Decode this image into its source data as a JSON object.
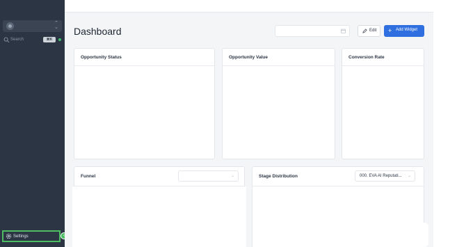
{
  "sidebar": {
    "search_label": "Search",
    "search_shortcut": "⌘K",
    "settings_label": "Settings"
  },
  "header": {
    "title": "Dashboard",
    "date_value": "",
    "edit_label": "Edit",
    "add_widget_label": "Add Widget"
  },
  "widgets": {
    "opportunity_status": {
      "title": "Opportunity Status"
    },
    "opportunity_value": {
      "title": "Opportunity Value"
    },
    "conversion_rate": {
      "title": "Conversion Rate"
    },
    "funnel": {
      "title": "Funnel",
      "select_value": ""
    },
    "stage_distribution": {
      "title": "Stage Distribution",
      "select_value": "000. EVA AI Reputati..."
    }
  },
  "colors": {
    "sidebar_bg": "#2b3544",
    "accent": "#2f6fdf",
    "highlight": "#4dbd61"
  }
}
